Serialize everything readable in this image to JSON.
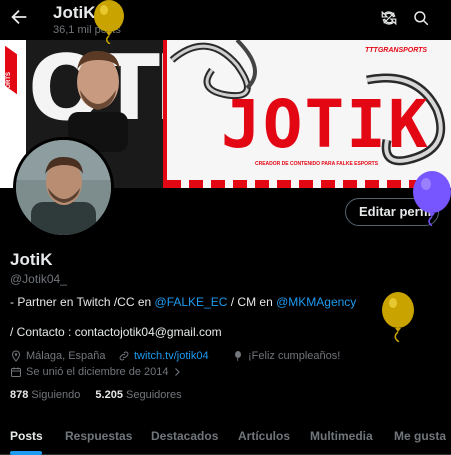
{
  "header": {
    "name": "JotiK",
    "posts_count": "36,1 mil posts"
  },
  "banner": {
    "left_text": "OTI",
    "left_tag": "FALKE ESPORTS",
    "title": "JOTIK",
    "subtitle": "CREADOR DE CONTENIDO PARA FALKE ESPORTS",
    "brand": "TTTGRANSPORTS"
  },
  "profile": {
    "edit_button": "Editar perfil",
    "name": "JotiK",
    "handle": "@Jotik04_",
    "bio_line1_prefix": "- Partner en Twitch /CC en ",
    "bio_link1": "@FALKE_EC",
    "bio_line1_middle": " / CM en ",
    "bio_link2": "@MKMAgency",
    "bio_line2": "/ Contacto : contactojotik04@gmail.com",
    "location": "Málaga, España",
    "website": "twitch.tv/jotik04",
    "birthday": "¡Feliz cumpleaños!",
    "joined": "Se unió el diciembre de 2014",
    "following_count": "878",
    "following_label": "Siguiendo",
    "followers_count": "5.205",
    "followers_label": "Seguidores"
  },
  "tabs": [
    {
      "label": "Posts",
      "active": true
    },
    {
      "label": "Respuestas",
      "active": false
    },
    {
      "label": "Destacados",
      "active": false
    },
    {
      "label": "Artículos",
      "active": false
    },
    {
      "label": "Multimedia",
      "active": false
    },
    {
      "label": "Me gusta",
      "active": false
    }
  ],
  "colors": {
    "accent": "#1d9bf0",
    "muted": "#71767b",
    "banner_red": "#e30613",
    "balloon_yellow": "#c9a400",
    "balloon_purple": "#7856ff"
  },
  "icons": [
    "back-arrow-icon",
    "refresh-icon",
    "search-icon",
    "location-icon",
    "link-icon",
    "balloon-icon",
    "calendar-icon",
    "chevron-right-icon"
  ]
}
